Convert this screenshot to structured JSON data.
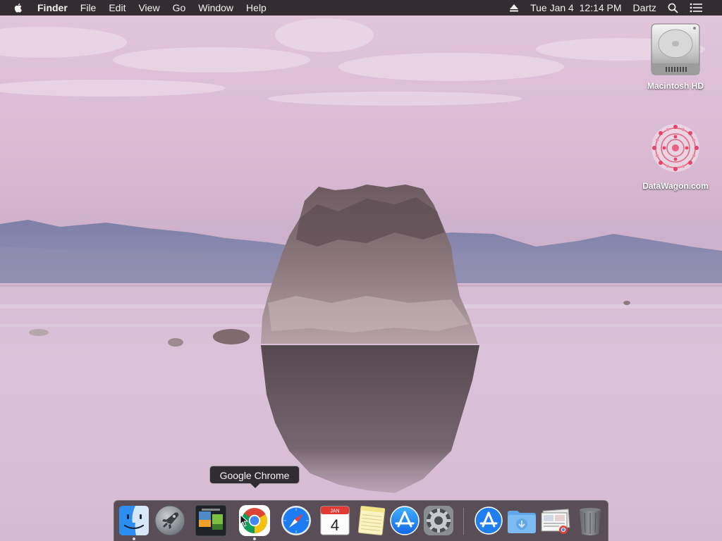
{
  "menubar": {
    "app_name": "Finder",
    "items": [
      "File",
      "Edit",
      "View",
      "Go",
      "Window",
      "Help"
    ],
    "clock": "Tue Jan 4  12:14 PM",
    "user": "Dartz"
  },
  "desktop": {
    "icons": [
      {
        "label": "Macintosh HD",
        "icon": "hard-drive-icon"
      },
      {
        "label": "DataWagon.com",
        "icon": "disk-image-icon"
      }
    ]
  },
  "tooltip": {
    "text": "Google Chrome"
  },
  "dock": {
    "items": [
      {
        "name": "Finder",
        "icon": "finder-icon",
        "running": true
      },
      {
        "name": "Launchpad",
        "icon": "launchpad-icon",
        "running": false
      },
      {
        "name": "Image Capture",
        "icon": "image-capture-icon",
        "running": false
      },
      {
        "name": "Google Chrome",
        "icon": "chrome-icon",
        "running": true
      },
      {
        "name": "Safari",
        "icon": "safari-icon",
        "running": false
      },
      {
        "name": "Calendar",
        "icon": "calendar-icon",
        "running": false,
        "month": "JAN",
        "day": "4"
      },
      {
        "name": "Notes",
        "icon": "notes-icon",
        "running": false
      },
      {
        "name": "App Store",
        "icon": "app-store-icon",
        "running": false
      },
      {
        "name": "System Preferences",
        "icon": "system-preferences-icon",
        "running": false
      },
      {
        "name": "Applications",
        "icon": "applications-folder-icon",
        "running": false
      },
      {
        "name": "Downloads",
        "icon": "downloads-folder-icon",
        "running": false
      },
      {
        "name": "Screenshots",
        "icon": "stack-icon",
        "running": false
      },
      {
        "name": "Trash",
        "icon": "trash-icon",
        "running": false
      }
    ]
  },
  "colors": {
    "menubar_bg": "#241e22",
    "accent_blue": "#1d7cf2",
    "chrome_red": "#db4437",
    "chrome_yellow": "#f4c20d",
    "chrome_green": "#0f9d58"
  }
}
